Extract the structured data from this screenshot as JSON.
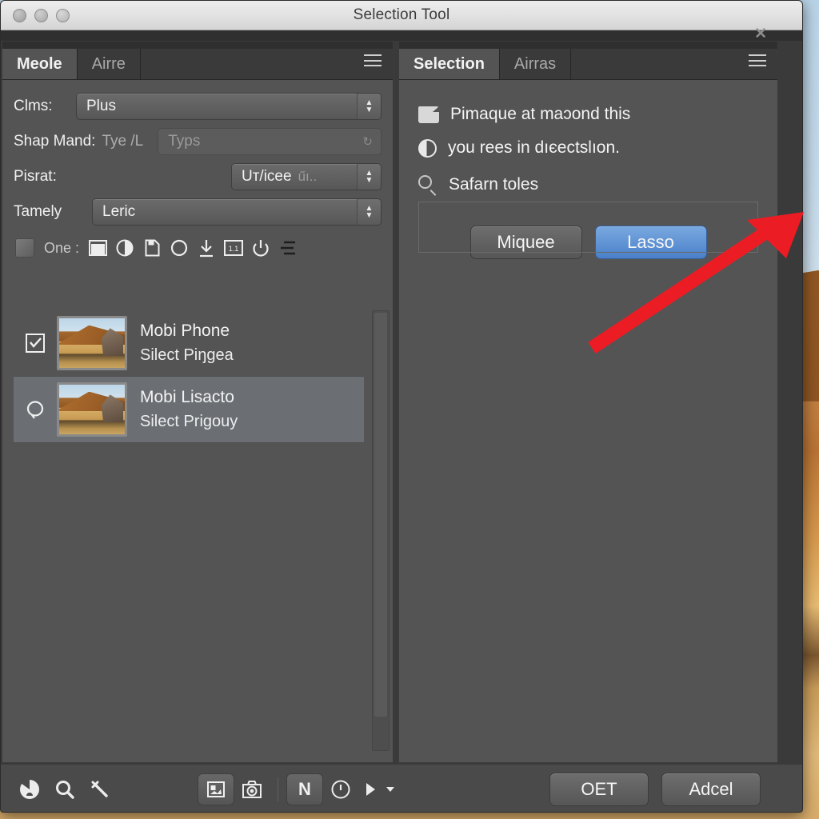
{
  "window": {
    "title": "Selection Tool",
    "close_marker": "✕",
    "traffic_lights": [
      "close-button",
      "minimize-button",
      "zoom-button"
    ]
  },
  "left_panel": {
    "tabs": [
      {
        "label": "Meole",
        "active": true
      },
      {
        "label": "Airre",
        "active": false
      }
    ],
    "menu_icon": "hamburger-menu-icon",
    "fields": [
      {
        "label": "Clms:",
        "value": "Plus",
        "kind": "combo"
      },
      {
        "label": "Shap Mand:",
        "secondary_label": "Tye /L",
        "value": "Typs",
        "kind": "text"
      },
      {
        "label": "Pisrat:",
        "value": "Uт/icee",
        "value_suffix": "űı..",
        "kind": "combo"
      },
      {
        "label": "Tamely",
        "value": "Leric",
        "kind": "combo"
      }
    ],
    "icon_row": {
      "label": "One :",
      "swatch": "color-swatch",
      "icons": [
        "filled-square-icon",
        "half-circle-contrast-icon",
        "save-disk-icon",
        "circle-outline-icon",
        "download-arrow-icon",
        "dimension-box-icon",
        "power-icon",
        "align-lines-icon"
      ]
    },
    "list": [
      {
        "state_icon": "checkbox-checked-icon",
        "thumbnail": "desert-dune-thumbnail",
        "title": "Mobi Phone",
        "subtitle": "Silect Piŋgea",
        "selected": false
      },
      {
        "state_icon": "lasso-loop-icon",
        "thumbnail": "desert-dune-thumbnail",
        "title": "Mobi Lisacto",
        "subtitle": "Silect Prigouy",
        "selected": true
      }
    ]
  },
  "right_panel": {
    "tabs": [
      {
        "label": "Selection",
        "active": true
      },
      {
        "label": "Airras",
        "active": false
      }
    ],
    "menu_icon": "hamburger-menu-icon",
    "lines": [
      {
        "icon": "folder-icon",
        "text": "Pimaque at maɔond this"
      },
      {
        "icon": "radio-half-icon",
        "text": "you rees in dıєectslıon."
      },
      {
        "icon": "search-icon",
        "text": "Safarn toles"
      }
    ],
    "buttons": [
      {
        "label": "Miquee",
        "primary": false
      },
      {
        "label": "Lasso",
        "primary": true
      }
    ]
  },
  "bottom_bar": {
    "left_icons": [
      "color-wheel-icon",
      "magnifier-icon",
      "hammer-tool-icon"
    ],
    "center_icons": [
      "image-placeholder-icon",
      "camera-icon"
    ],
    "toggle_label": "N",
    "history_icon": "history-clock-icon",
    "play_icon": "play-triangle-icon",
    "dropdown_icon": "chevron-down-icon",
    "buttons": [
      {
        "label": "OET",
        "primary": false
      },
      {
        "label": "Adcel",
        "primary": false
      }
    ]
  },
  "annotation": {
    "arrow": "red-pointer-arrow",
    "arrow_color": "#ec1c24",
    "points_at": "Lasso"
  },
  "colors": {
    "panel_bg": "#545454",
    "window_bg": "#3a3a3a",
    "accent_blue": "#4a80c9",
    "selected_row": "#6b6f74",
    "titlebar": "#e2e2e2"
  }
}
